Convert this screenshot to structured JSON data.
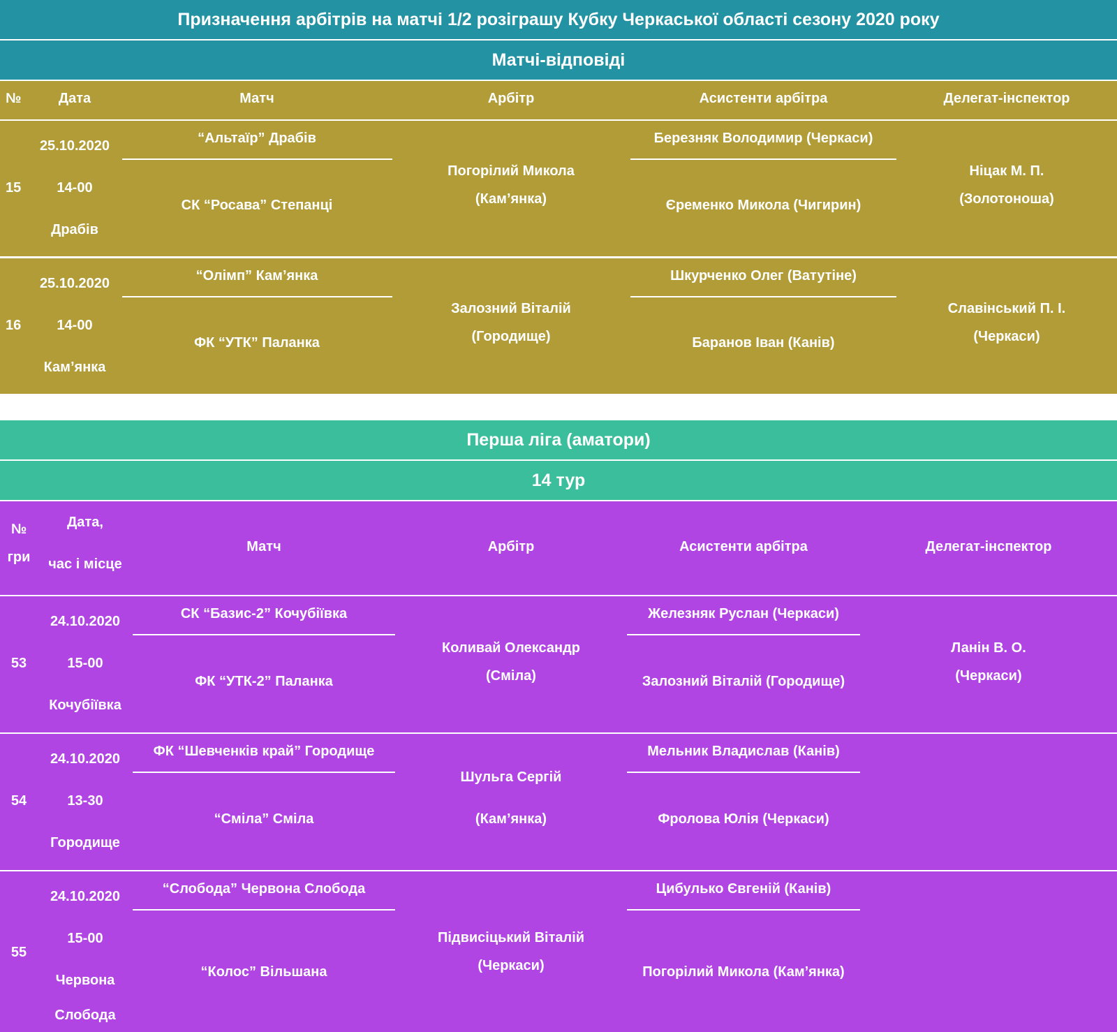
{
  "title": "Призначення арбітрів на матчі 1/2 розіграшу Кубку Черкаської області сезону 2020 року",
  "cup": {
    "subtitle": "Матчі-відповіді",
    "headers": {
      "num": "№",
      "date": "Дата",
      "match": "Матч",
      "referee": "Арбітр",
      "assistants": "Асистенти арбітра",
      "delegate": "Делегат-інспектор"
    },
    "rows": [
      {
        "num": "15",
        "date": "25.10.2020",
        "time": "14-00",
        "place": "Драбів",
        "home": "“Альтаїр” Драбів",
        "away": "СК “Росава” Степанці",
        "referee_name": "Погорілий Микола",
        "referee_city": "(Кам’янка)",
        "assistant1": "Березняк Володимир (Черкаси)",
        "assistant2": "Єременко Микола (Чигирин)",
        "delegate_name": "Ніцак М. П.",
        "delegate_city": "(Золотоноша)"
      },
      {
        "num": "16",
        "date": "25.10.2020",
        "time": "14-00",
        "place": "Кам’янка",
        "home": "“Олімп” Кам’янка",
        "away": "ФК “УТК” Паланка",
        "referee_name": "Залозний Віталій",
        "referee_city": "(Городище)",
        "assistant1": "Шкурченко Олег (Ватутіне)",
        "assistant2": "Баранов Іван (Канів)",
        "delegate_name": "Славінський П. І.",
        "delegate_city": "(Черкаси)"
      }
    ]
  },
  "league": {
    "title": "Перша ліга (аматори)",
    "round": "14 тур",
    "headers": {
      "num_line1": "№",
      "num_line2": "гри",
      "date_line1": "Дата,",
      "date_line2": "час і місце",
      "match": "Матч",
      "referee": "Арбітр",
      "assistants": "Асистенти арбітра",
      "delegate": "Делегат-інспектор"
    },
    "rows": [
      {
        "num": "53",
        "date": "24.10.2020",
        "time": "15-00",
        "place": "Кочубіївка",
        "place2": "",
        "home": "СК “Базис-2” Кочубіївка",
        "away": "ФК “УТК-2” Паланка",
        "referee_name": "Коливай Олександр",
        "referee_city": "(Сміла)",
        "assistant1": "Железняк Руслан (Черкаси)",
        "assistant2": "Залозний Віталій (Городище)",
        "delegate_name": "Ланін В. О.",
        "delegate_city": "(Черкаси)"
      },
      {
        "num": "54",
        "date": "24.10.2020",
        "time": "13-30",
        "place": "Городище",
        "place2": "",
        "home": "ФК “Шевченків край” Городище",
        "away": "“Сміла” Сміла",
        "referee_name": "Шульга Сергій",
        "referee_city": "(Кам’янка)",
        "assistant1": "Мельник Владислав (Канів)",
        "assistant2": "Фролова Юлія (Черкаси)",
        "delegate_name": "",
        "delegate_city": ""
      },
      {
        "num": "55",
        "date": "24.10.2020",
        "time": "15-00",
        "place": "Червона",
        "place2": "Слобода",
        "home": "“Слобода” Червона Слобода",
        "away": "“Колос” Вільшана",
        "referee_name": "Підвисіцький Віталій",
        "referee_city": "(Черкаси)",
        "assistant1": "Цибулько Євгеній (Канів)",
        "assistant2": "Погорілий Микола (Кам’янка)",
        "delegate_name": "",
        "delegate_city": ""
      }
    ]
  },
  "colors": {
    "teal": "#2393a4",
    "mint": "#3bbe9c",
    "olive": "#b19c37",
    "purple": "#b145e4"
  }
}
